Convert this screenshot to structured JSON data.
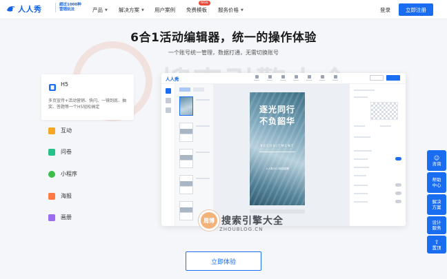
{
  "nav": {
    "logo_text": "人人秀",
    "logo_sub_1": "超过1000种",
    "logo_sub_2": "营销玩法",
    "items": [
      {
        "label": "产品",
        "has_caret": true
      },
      {
        "label": "解决方案",
        "has_caret": true
      },
      {
        "label": "用户案例",
        "has_caret": false
      },
      {
        "label": "免费模板",
        "has_caret": false
      },
      {
        "label": "服务价格",
        "has_caret": true
      }
    ],
    "badge": "NEW",
    "login": "登录",
    "register": "立即注册"
  },
  "hero": {
    "title": "6合1活动编辑器，统一的操作体验",
    "subtitle": "一个账号统一管理，数据打通，无需切换账号"
  },
  "features": {
    "active": {
      "icon": "h5-icon",
      "title": "H5",
      "desc": "多页宣传+活动营销、快闪、一镜到底、抽奖、答题等一个H5轻松搞定"
    },
    "items": [
      {
        "label": "互动",
        "icon": "interaction-icon",
        "color": "#f5a623"
      },
      {
        "label": "问卷",
        "icon": "survey-icon",
        "color": "#27c08a"
      },
      {
        "label": "小程序",
        "icon": "miniprogram-icon",
        "color": "#3bbf4a"
      },
      {
        "label": "海报",
        "icon": "poster-icon",
        "color": "#ff7a45"
      },
      {
        "label": "画册",
        "icon": "album-icon",
        "color": "#9b6bf0"
      }
    ]
  },
  "editor": {
    "logo": "人人秀",
    "poster": {
      "line1": "逐光同行",
      "line2": "不负韶华",
      "en": "RECRUITMENT",
      "foot": "人人秀2023校园招聘"
    }
  },
  "watermark": {
    "text": "搜索引擎大全",
    "url": "ZHOUBLOG.CN",
    "badge": "周博"
  },
  "cta": "立即体验",
  "float": [
    {
      "label": "咨询",
      "icon": "chat-icon"
    },
    {
      "label": "帮助中心",
      "icon": "help-icon"
    },
    {
      "label": "解决方案",
      "icon": "solution-icon"
    },
    {
      "label": "设计服务",
      "icon": "design-icon"
    },
    {
      "label": "置顶",
      "icon": "arrow-up-icon"
    }
  ],
  "colors": {
    "brand": "#1a6cf0",
    "badge": "#e84b3c"
  }
}
